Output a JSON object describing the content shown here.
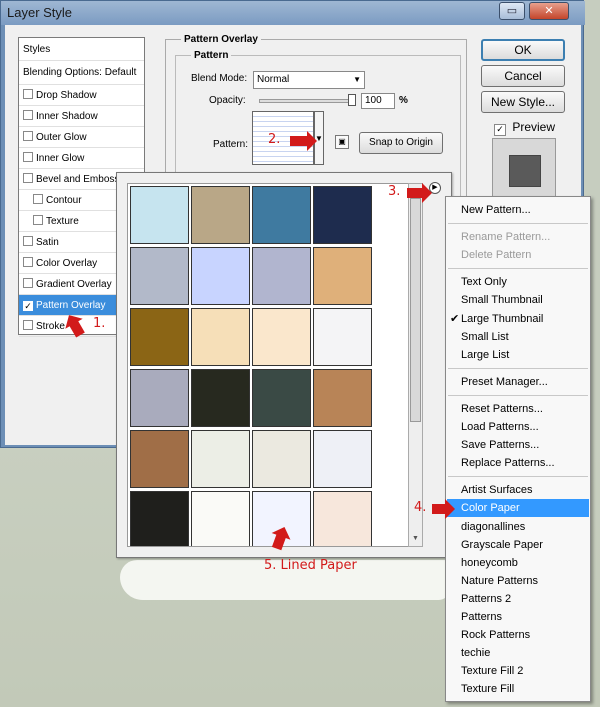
{
  "window": {
    "title": "Layer Style",
    "titlebar_buttons": [
      "minimize-icon",
      "close-icon"
    ]
  },
  "styles_list": {
    "header": "Styles",
    "blending": "Blending Options: Default",
    "items": [
      {
        "label": "Drop Shadow",
        "checked": false
      },
      {
        "label": "Inner Shadow",
        "checked": false
      },
      {
        "label": "Outer Glow",
        "checked": false
      },
      {
        "label": "Inner Glow",
        "checked": false
      },
      {
        "label": "Bevel and Emboss",
        "checked": false
      },
      {
        "label": "Contour",
        "checked": false
      },
      {
        "label": "Texture",
        "checked": false
      },
      {
        "label": "Satin",
        "checked": false
      },
      {
        "label": "Color Overlay",
        "checked": false
      },
      {
        "label": "Gradient Overlay",
        "checked": false
      },
      {
        "label": "Pattern Overlay",
        "checked": true
      },
      {
        "label": "Stroke",
        "checked": false
      }
    ]
  },
  "panel": {
    "group_title": "Pattern Overlay",
    "subgroup_title": "Pattern",
    "blend_mode_label": "Blend Mode:",
    "blend_mode_value": "Normal",
    "opacity_label": "Opacity:",
    "opacity_value": "100",
    "opacity_unit": "%",
    "opacity_level": 1.0,
    "pattern_label": "Pattern:",
    "snap_button": "Snap to Origin"
  },
  "buttons": {
    "ok": "OK",
    "cancel": "Cancel",
    "new_style": "New Style...",
    "preview": "Preview"
  },
  "picker": {
    "tiles": [
      "#c6e4ef",
      "#b9a787",
      "#3f7aa0",
      "#1e2c4e",
      "#b2b9c9",
      "#c8d4ff",
      "#b1b5cf",
      "#dfb07a",
      "#8b6515",
      "#f6dfb8",
      "#fae7cc",
      "#f4f4f6",
      "#a9abbd",
      "#27291f",
      "#3a4a45",
      "#b88457",
      "#a06e47",
      "#eceee6",
      "#ebe9e0",
      "#eef0f6",
      "#1f1f1c",
      "#fafaf7",
      "#f2f4ff",
      "#f7e7dc"
    ]
  },
  "menu": {
    "items": [
      {
        "label": "New Pattern...",
        "state": "normal"
      },
      {
        "label": "Rename Pattern...",
        "state": "disabled"
      },
      {
        "label": "Delete Pattern",
        "state": "disabled"
      },
      {
        "label": "Text Only",
        "state": "normal"
      },
      {
        "label": "Small Thumbnail",
        "state": "normal"
      },
      {
        "label": "Large Thumbnail",
        "state": "checked"
      },
      {
        "label": "Small List",
        "state": "normal"
      },
      {
        "label": "Large List",
        "state": "normal"
      },
      {
        "label": "Preset Manager...",
        "state": "normal"
      },
      {
        "label": "Reset Patterns...",
        "state": "normal"
      },
      {
        "label": "Load Patterns...",
        "state": "normal"
      },
      {
        "label": "Save Patterns...",
        "state": "normal"
      },
      {
        "label": "Replace Patterns...",
        "state": "normal"
      },
      {
        "label": "Artist Surfaces",
        "state": "normal"
      },
      {
        "label": "Color Paper",
        "state": "selected"
      },
      {
        "label": "diagonallines",
        "state": "normal"
      },
      {
        "label": "Grayscale Paper",
        "state": "normal"
      },
      {
        "label": "honeycomb",
        "state": "normal"
      },
      {
        "label": "Nature Patterns",
        "state": "normal"
      },
      {
        "label": "Patterns 2",
        "state": "normal"
      },
      {
        "label": "Patterns",
        "state": "normal"
      },
      {
        "label": "Rock Patterns",
        "state": "normal"
      },
      {
        "label": "techie",
        "state": "normal"
      },
      {
        "label": "Texture Fill 2",
        "state": "normal"
      },
      {
        "label": "Texture Fill",
        "state": "normal"
      }
    ]
  },
  "annotations": {
    "step1": "1.",
    "step2": "2.",
    "step3": "3.",
    "step4": "4.",
    "step5": "5. Lined Paper"
  }
}
